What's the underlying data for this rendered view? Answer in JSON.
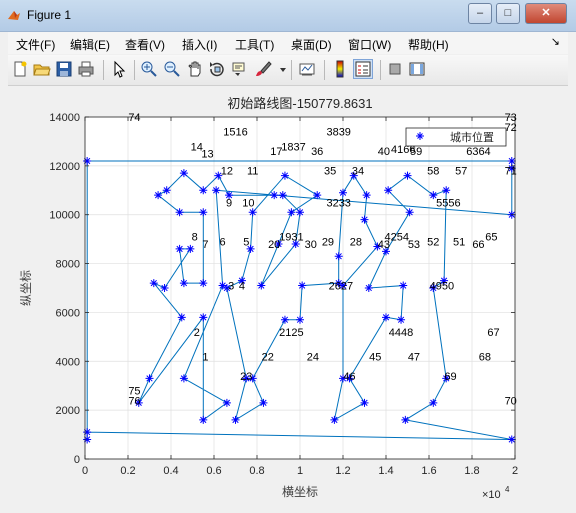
{
  "window": {
    "title": "Figure 1",
    "minimize": "–",
    "restore": "□",
    "close": "✕"
  },
  "menu": {
    "items": [
      "文件(F)",
      "编辑(E)",
      "查看(V)",
      "插入(I)",
      "工具(T)",
      "桌面(D)",
      "窗口(W)",
      "帮助(H)"
    ],
    "overflow": "↘"
  },
  "toolbar": {
    "icons": [
      "new-figure-icon",
      "open-folder-icon",
      "save-icon",
      "print-icon",
      "select-pointer-icon",
      "zoom-in-icon",
      "zoom-out-icon",
      "pan-hand-icon",
      "rotate-3d-icon",
      "data-cursor-icon",
      "brush-icon",
      "brush-dropdown-icon",
      "link-plot-icon",
      "colorbar-icon",
      "legend-icon",
      "hide-plot-tools-icon",
      "show-plot-tools-icon"
    ]
  },
  "chart_data": {
    "type": "line",
    "title": "初始路线图-150779.8631",
    "xlabel": "横坐标",
    "ylabel": "纵坐标",
    "x_exponent_label": "×10",
    "x_exponent_power": "4",
    "xlim": [
      0,
      20000
    ],
    "ylim": [
      0,
      14000
    ],
    "x_ticks": [
      0,
      2000,
      4000,
      6000,
      8000,
      10000,
      12000,
      14000,
      16000,
      18000,
      20000
    ],
    "x_tick_labels": [
      "0",
      "0.2",
      "0.4",
      "0.6",
      "0.8",
      "1",
      "1.2",
      "1.4",
      "1.6",
      "1.8",
      "2"
    ],
    "y_ticks": [
      0,
      2000,
      4000,
      6000,
      8000,
      10000,
      12000,
      14000
    ],
    "y_tick_labels": [
      "0",
      "2000",
      "4000",
      "6000",
      "8000",
      "10000",
      "12000",
      "14000"
    ],
    "grid": true,
    "legend": {
      "label": "城市位置",
      "placement": "top-right"
    },
    "line_color": "#0072bd",
    "marker_color": "#0000ff",
    "route": [
      [
        100,
        12200
      ],
      [
        100,
        800
      ],
      [
        100,
        1100
      ],
      [
        19850,
        800
      ],
      [
        14900,
        1600
      ],
      [
        16200,
        2300
      ],
      [
        16800,
        3300
      ],
      [
        16200,
        7000
      ],
      [
        16700,
        7300
      ],
      [
        16800,
        11000
      ],
      [
        16200,
        10800
      ],
      [
        15000,
        11600
      ],
      [
        14100,
        11000
      ],
      [
        15100,
        10100
      ],
      [
        14000,
        8500
      ],
      [
        13200,
        7000
      ],
      [
        14800,
        7100
      ],
      [
        14700,
        5700
      ],
      [
        14000,
        5800
      ],
      [
        12300,
        3300
      ],
      [
        13000,
        2300
      ],
      [
        11600,
        1600
      ],
      [
        12000,
        3300
      ],
      [
        12000,
        7100
      ],
      [
        13600,
        8700
      ],
      [
        13000,
        9800
      ],
      [
        13100,
        10800
      ],
      [
        12500,
        11600
      ],
      [
        12000,
        10900
      ],
      [
        11800,
        8300
      ],
      [
        11800,
        7200
      ],
      [
        10100,
        7100
      ],
      [
        10000,
        5700
      ],
      [
        9300,
        5700
      ],
      [
        7800,
        3300
      ],
      [
        8300,
        2300
      ],
      [
        7000,
        1600
      ],
      [
        7500,
        3300
      ],
      [
        6600,
        7000
      ],
      [
        7300,
        7300
      ],
      [
        7700,
        8600
      ],
      [
        7800,
        10100
      ],
      [
        9300,
        11600
      ],
      [
        10800,
        10800
      ],
      [
        9600,
        10100
      ],
      [
        9000,
        8800
      ],
      [
        8200,
        7100
      ],
      [
        9800,
        8800
      ],
      [
        10000,
        10100
      ],
      [
        9200,
        10800
      ],
      [
        8800,
        10800
      ],
      [
        6700,
        10800
      ],
      [
        6200,
        11600
      ],
      [
        5500,
        11000
      ],
      [
        4600,
        11700
      ],
      [
        3800,
        11000
      ],
      [
        3400,
        10800
      ],
      [
        4400,
        10100
      ],
      [
        5500,
        10100
      ],
      [
        5500,
        7200
      ],
      [
        4600,
        7200
      ],
      [
        4400,
        8600
      ],
      [
        4900,
        8600
      ],
      [
        3700,
        7000
      ],
      [
        3200,
        7200
      ],
      [
        4500,
        5800
      ],
      [
        3000,
        3300
      ],
      [
        2500,
        2300
      ],
      [
        5500,
        5800
      ],
      [
        5500,
        1600
      ],
      [
        6600,
        2300
      ],
      [
        4600,
        3300
      ],
      [
        6400,
        7100
      ],
      [
        6100,
        11000
      ],
      [
        19850,
        10000
      ],
      [
        19850,
        11900
      ],
      [
        19850,
        12200
      ],
      [
        100,
        12200
      ]
    ],
    "point_labels": [
      [
        "74",
        2300,
        14000
      ],
      [
        "1516",
        7000,
        13400
      ],
      [
        "3839",
        11800,
        13400
      ],
      [
        "73",
        19800,
        14000
      ],
      [
        "72",
        19800,
        13600
      ],
      [
        "14",
        5200,
        12800
      ],
      [
        "13",
        5700,
        12500
      ],
      [
        "1837",
        9700,
        12800
      ],
      [
        "17",
        8900,
        12600
      ],
      [
        "36",
        10800,
        12600
      ],
      [
        "40",
        13900,
        12600
      ],
      [
        "4166",
        14800,
        12700
      ],
      [
        "59",
        15400,
        12600
      ],
      [
        "6162",
        16800,
        13400
      ],
      [
        "6364",
        18300,
        12600
      ],
      [
        "12",
        6600,
        11800
      ],
      [
        "11",
        7800,
        11800
      ],
      [
        "35",
        11400,
        11800
      ],
      [
        "34",
        12700,
        11800
      ],
      [
        "58",
        16200,
        11800
      ],
      [
        "57",
        17500,
        11800
      ],
      [
        "71",
        19800,
        11800
      ],
      [
        "9",
        6700,
        10500
      ],
      [
        "10",
        7600,
        10500
      ],
      [
        "3233",
        11800,
        10500
      ],
      [
        "5556",
        16900,
        10500
      ],
      [
        "8",
        5100,
        9100
      ],
      [
        "7",
        5600,
        8800
      ],
      [
        "6",
        6400,
        8900
      ],
      [
        "5",
        7500,
        8900
      ],
      [
        "20",
        8800,
        8800
      ],
      [
        "1931",
        9600,
        9100
      ],
      [
        "30",
        10500,
        8800
      ],
      [
        "29",
        11300,
        8900
      ],
      [
        "28",
        12600,
        8900
      ],
      [
        "43",
        13900,
        8800
      ],
      [
        "4254",
        14500,
        9100
      ],
      [
        "53",
        15300,
        8800
      ],
      [
        "52",
        16200,
        8900
      ],
      [
        "51",
        17400,
        8900
      ],
      [
        "66",
        18300,
        8800
      ],
      [
        "65",
        18900,
        9100
      ],
      [
        "3",
        6800,
        7100
      ],
      [
        "4",
        7300,
        7100
      ],
      [
        "2627",
        11900,
        7100
      ],
      [
        "4950",
        16600,
        7100
      ],
      [
        "2",
        5200,
        5200
      ],
      [
        "2125",
        9600,
        5200
      ],
      [
        "4448",
        14700,
        5200
      ],
      [
        "67",
        19000,
        5200
      ],
      [
        "1",
        5600,
        4200
      ],
      [
        "22",
        8500,
        4200
      ],
      [
        "24",
        10600,
        4200
      ],
      [
        "45",
        13500,
        4200
      ],
      [
        "47",
        15300,
        4200
      ],
      [
        "68",
        18600,
        4200
      ],
      [
        "23",
        7500,
        3400
      ],
      [
        "46",
        12300,
        3400
      ],
      [
        "69",
        17000,
        3400
      ],
      [
        "75",
        2300,
        2800
      ],
      [
        "76",
        2300,
        2400
      ],
      [
        "70",
        19800,
        2400
      ]
    ]
  }
}
